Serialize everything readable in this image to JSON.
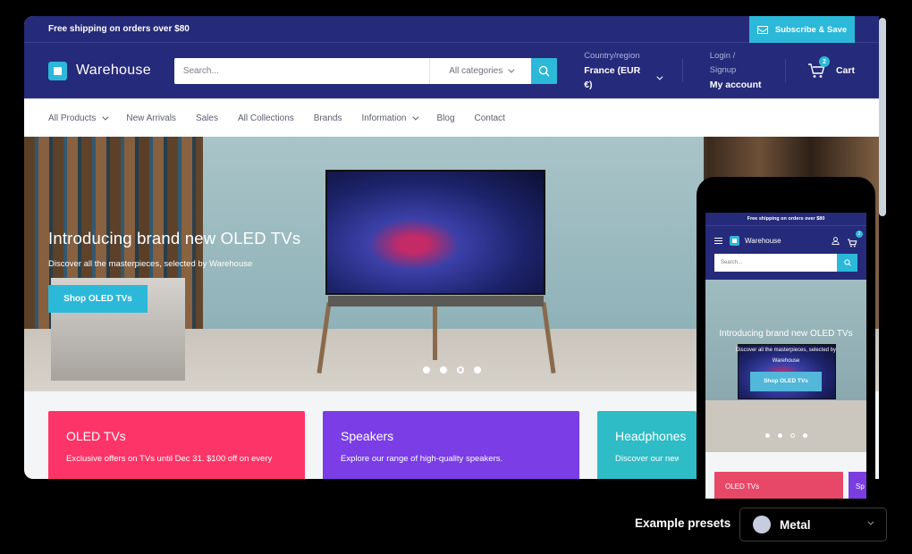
{
  "announcement": {
    "text": "Free shipping on orders over $80",
    "subscribe_label": "Subscribe & Save"
  },
  "header": {
    "logo_text": "Warehouse",
    "search": {
      "placeholder": "Search...",
      "category": "All categories"
    },
    "country": {
      "label": "Country/region",
      "value": "France (EUR €)"
    },
    "account": {
      "label": "Login / Signup",
      "value": "My account"
    },
    "cart": {
      "label": "Cart",
      "count": "2"
    }
  },
  "nav": {
    "items": [
      {
        "label": "All Products",
        "has_dropdown": true
      },
      {
        "label": "New Arrivals",
        "has_dropdown": false
      },
      {
        "label": "Sales",
        "has_dropdown": false
      },
      {
        "label": "All Collections",
        "has_dropdown": false
      },
      {
        "label": "Brands",
        "has_dropdown": false
      },
      {
        "label": "Information",
        "has_dropdown": true
      },
      {
        "label": "Blog",
        "has_dropdown": false
      },
      {
        "label": "Contact",
        "has_dropdown": false
      }
    ]
  },
  "hero": {
    "title": "Introducing brand new OLED TVs",
    "subtitle": "Discover all the masterpieces, selected by Warehouse",
    "button_label": "Shop OLED TVs",
    "slide_count": 4,
    "active_slide": 3
  },
  "cards": [
    {
      "title": "OLED TVs",
      "description": "Exclusive offers on TVs until Dec 31. $100 off on every",
      "color": "#fd3467"
    },
    {
      "title": "Speakers",
      "description": "Explore our range of high-quality speakers.",
      "color": "#7a3de6"
    },
    {
      "title": "Headphones",
      "description": "Discover our new he",
      "color": "#2ebcc6"
    }
  ],
  "mobile": {
    "announcement": "Free shipping on orders over $80",
    "logo_text": "Warehouse",
    "search_placeholder": "Search...",
    "cart_count": "2",
    "hero_title": "Introducing brand new OLED TVs",
    "hero_subtitle": "Discover all the masterpieces, selected by Warehouse",
    "hero_button": "Shop OLED TVs",
    "card_title": "OLED TVs",
    "card2_title": "Sp"
  },
  "presets": {
    "label": "Example presets",
    "selected": "Metal",
    "swatch_color": "#c8cce0"
  },
  "colors": {
    "primary": "#262a7a",
    "accent": "#2cb8d9"
  }
}
